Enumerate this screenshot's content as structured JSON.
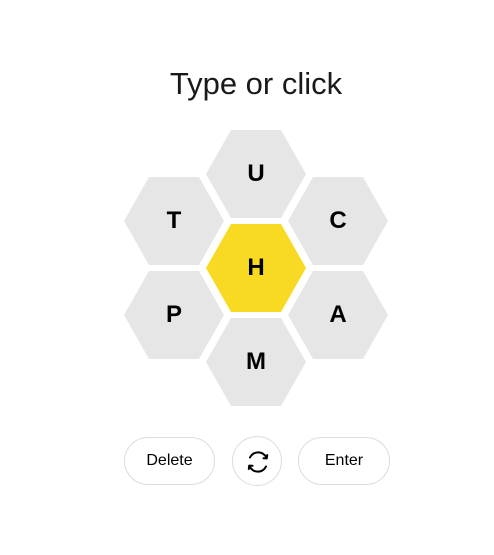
{
  "prompt": {
    "text": "Type or click"
  },
  "hive": {
    "center_letter": "H",
    "center_color": "#f7da21",
    "outer_color": "#e6e6e6",
    "letters": {
      "top": "U",
      "top_left": "T",
      "top_right": "C",
      "center": "H",
      "bottom_left": "P",
      "bottom_right": "A",
      "bottom": "M"
    }
  },
  "controls": {
    "delete_label": "Delete",
    "shuffle_icon": "shuffle-icon",
    "enter_label": "Enter"
  }
}
